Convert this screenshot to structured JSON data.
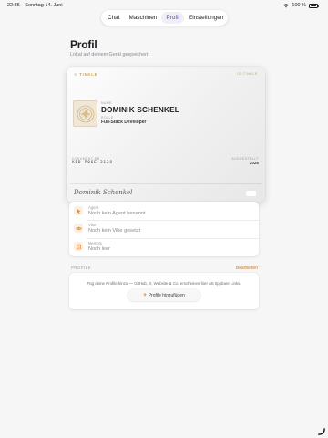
{
  "status_bar": {
    "time": "22:35",
    "date": "Sonntag 14. Juni",
    "battery": "100 %"
  },
  "tabs": [
    {
      "label": "Chat"
    },
    {
      "label": "Maschinen"
    },
    {
      "label": "Profil"
    },
    {
      "label": "Einstellungen"
    }
  ],
  "active_tab": "Profil",
  "header": {
    "title": "Profil",
    "subtitle": "Lokal auf deinem Gerät gespeichert"
  },
  "id_card": {
    "brand": "TINKLE",
    "code": "ID-TINKLE",
    "name_label": "NAME",
    "name": "DOMINIK SCHENKEL",
    "role_label": "ROLLE",
    "role": "Full-Stack Developer",
    "doc_label": "DOKUMENT-NR",
    "doc_number": "KED P06E 3128",
    "year_label": "AUSGESTELLT",
    "year": "2026",
    "signature": "Dominik Schenkel"
  },
  "info_rows": [
    {
      "label": "Agent",
      "value": "Noch kein Agent benannt",
      "icon": "agent-icon"
    },
    {
      "label": "Vibe",
      "value": "Noch kein Vibe gesetzt",
      "icon": "vibe-icon"
    },
    {
      "label": "Memory",
      "value": "Noch leer",
      "icon": "memory-icon"
    }
  ],
  "profiles": {
    "section_title": "PROFILE",
    "edit_label": "Bearbeiten",
    "description": "Füg deine Profile hinzu — GitHub, X, Website & Co. erscheinen hier als tippbare Links.",
    "add_button": "Profile hinzufügen"
  },
  "colors": {
    "accent": "#c07a2c",
    "active_tab": "#6a3fd0",
    "gold": "#c9a15a"
  }
}
